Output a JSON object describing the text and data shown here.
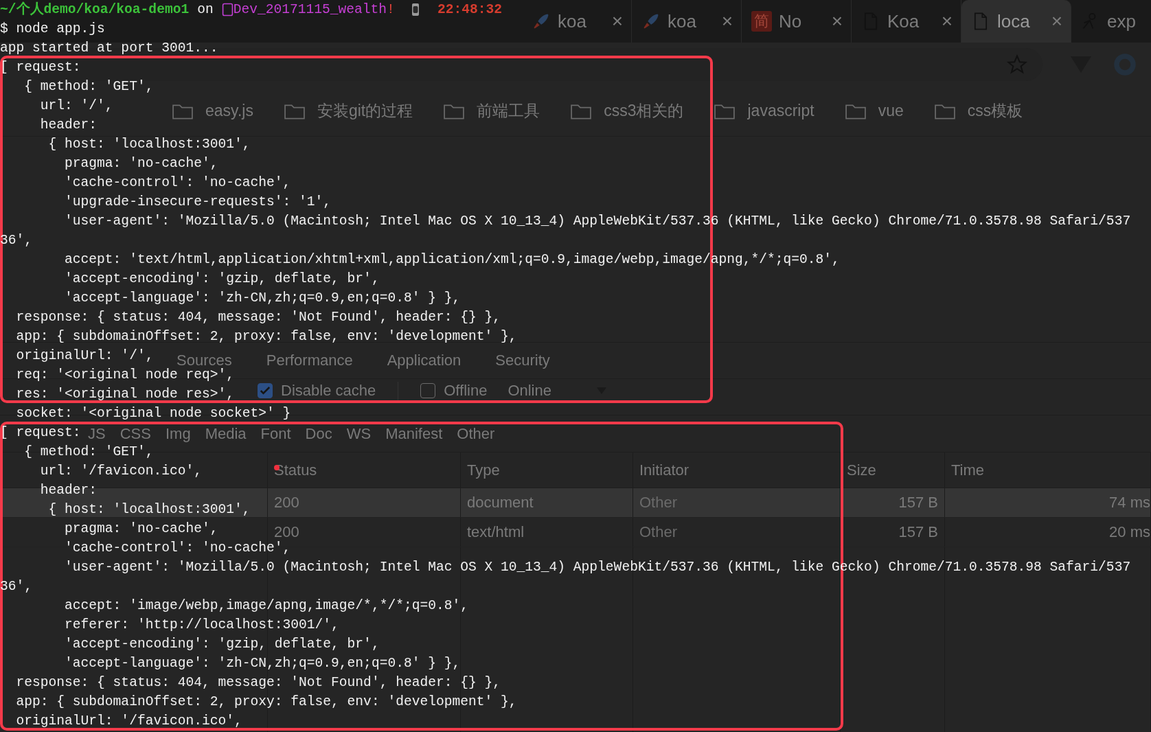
{
  "browser": {
    "tabs": [
      {
        "kind": "rocket",
        "label": "koa",
        "close": "×",
        "selected": false
      },
      {
        "kind": "rocket",
        "label": "koa",
        "close": "×",
        "selected": false
      },
      {
        "kind": "badge",
        "badge_text": "简",
        "label": "No",
        "close": "×",
        "selected": false
      },
      {
        "kind": "page",
        "label": "Koa",
        "close": "×",
        "selected": false
      },
      {
        "kind": "page",
        "label": "loca",
        "close": "×",
        "selected": true
      },
      {
        "kind": "figure",
        "label": "exp",
        "selected": false
      }
    ],
    "bookmarks": [
      "easy.js",
      "安装git的过程",
      "前端工具",
      "css3相关的",
      "javascript",
      "vue",
      "css模板"
    ]
  },
  "devtools": {
    "tabs": [
      "Sources",
      "Performance",
      "Application",
      "Security"
    ],
    "disable_cache": {
      "label": "Disable cache",
      "checked": true
    },
    "offline": {
      "label": "Offline",
      "checked": false
    },
    "throttle": "Online",
    "types": [
      "JS",
      "CSS",
      "Img",
      "Media",
      "Font",
      "Doc",
      "WS",
      "Manifest",
      "Other"
    ],
    "table": {
      "columns": [
        "Status",
        "Type",
        "Initiator",
        "Size",
        "Time"
      ],
      "rows": [
        {
          "cells": [
            "200",
            "document",
            "Other",
            "157 B",
            "74 ms"
          ],
          "selected": true
        },
        {
          "cells": [
            "200",
            "text/html",
            "Other",
            "157 B",
            "20 ms"
          ],
          "selected": false
        }
      ]
    }
  },
  "terminal": {
    "prompt": {
      "path": "~/个人demo/koa/koa-demo1",
      "on": "on",
      "branch": "Dev_20171115_wealth",
      "dirty": "!",
      "time": "22:48:32"
    },
    "lines": [
      "$ node app.js",
      "app started at port 3001...",
      "[ request:",
      "   { method: 'GET',",
      "     url: '/',",
      "     header:",
      "      { host: 'localhost:3001',",
      "        pragma: 'no-cache',",
      "        'cache-control': 'no-cache',",
      "        'upgrade-insecure-requests': '1',",
      "        'user-agent': 'Mozilla/5.0 (Macintosh; Intel Mac OS X 10_13_4) AppleWebKit/537.36 (KHTML, like Gecko) Chrome/71.0.3578.98 Safari/537",
      "36',",
      "        accept: 'text/html,application/xhtml+xml,application/xml;q=0.9,image/webp,image/apng,*/*;q=0.8',",
      "        'accept-encoding': 'gzip, deflate, br',",
      "        'accept-language': 'zh-CN,zh;q=0.9,en;q=0.8' } },",
      "  response: { status: 404, message: 'Not Found', header: {} },",
      "  app: { subdomainOffset: 2, proxy: false, env: 'development' },",
      "  originalUrl: '/',",
      "  req: '<original node req>',",
      "  res: '<original node res>',",
      "  socket: '<original node socket>' }",
      "[ request:",
      "   { method: 'GET',",
      "     url: '/favicon.ico',",
      "     header:",
      "      { host: 'localhost:3001',",
      "        pragma: 'no-cache',",
      "        'cache-control': 'no-cache',",
      "        'user-agent': 'Mozilla/5.0 (Macintosh; Intel Mac OS X 10_13_4) AppleWebKit/537.36 (KHTML, like Gecko) Chrome/71.0.3578.98 Safari/537",
      "36',",
      "        accept: 'image/webp,image/apng,image/*,*/*;q=0.8',",
      "        referer: 'http://localhost:3001/',",
      "        'accept-encoding': 'gzip, deflate, br',",
      "        'accept-language': 'zh-CN,zh;q=0.9,en;q=0.8' } },",
      "  response: { status: 404, message: 'Not Found', header: {} },",
      "  app: { subdomainOffset: 2, proxy: false, env: 'development' },",
      "  originalUrl: '/favicon.ico',"
    ]
  }
}
